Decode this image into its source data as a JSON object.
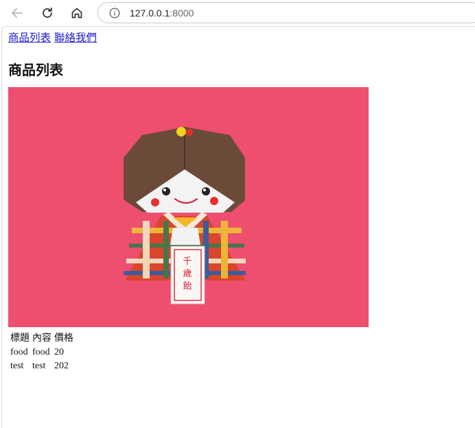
{
  "browser": {
    "url_host": "127.0.0.1",
    "url_port": ":8000"
  },
  "nav": {
    "links": [
      "商品列表",
      "聯絡我們"
    ]
  },
  "page_title": "商品列表",
  "product_image": {
    "description_icon": "origami-doll-image",
    "tag_text": "千歲飴",
    "background_color": "#ee4f6f"
  },
  "table": {
    "headers": [
      "標題",
      "內容",
      "價格"
    ],
    "rows": [
      [
        "food",
        "food",
        "20"
      ],
      [
        "test",
        "test",
        "202"
      ]
    ]
  }
}
